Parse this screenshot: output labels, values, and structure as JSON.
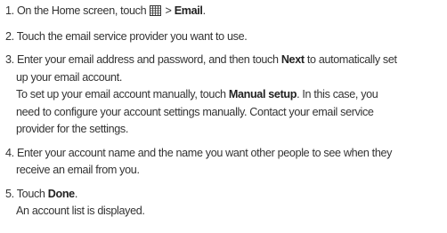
{
  "steps": [
    {
      "num": "1.",
      "parts": [
        "On the Home screen, touch",
        "> ",
        "Email",
        "."
      ],
      "icon": "apps-grid-icon"
    },
    {
      "num": "2.",
      "text": "Touch the email service provider you want to use."
    },
    {
      "num": "3.",
      "line1_pre": "Enter your email address and password, and then touch ",
      "line1_bold": "Next",
      "line1_post": " to automatically set",
      "line2": "up your email account.",
      "line3_pre": "To set up your email account manually, touch ",
      "line3_bold": "Manual setup",
      "line3_post": ". In this case, you",
      "line4": "need to configure your account settings manually. Contact your email service",
      "line5": "provider for the settings."
    },
    {
      "num": "4.",
      "line1": "Enter your account name and the name you want other people to see when they",
      "line2": "receive an email from you."
    },
    {
      "num": "5.",
      "pre": "Touch ",
      "bold": "Done",
      "post": ".",
      "line2": "An account list is displayed."
    }
  ]
}
